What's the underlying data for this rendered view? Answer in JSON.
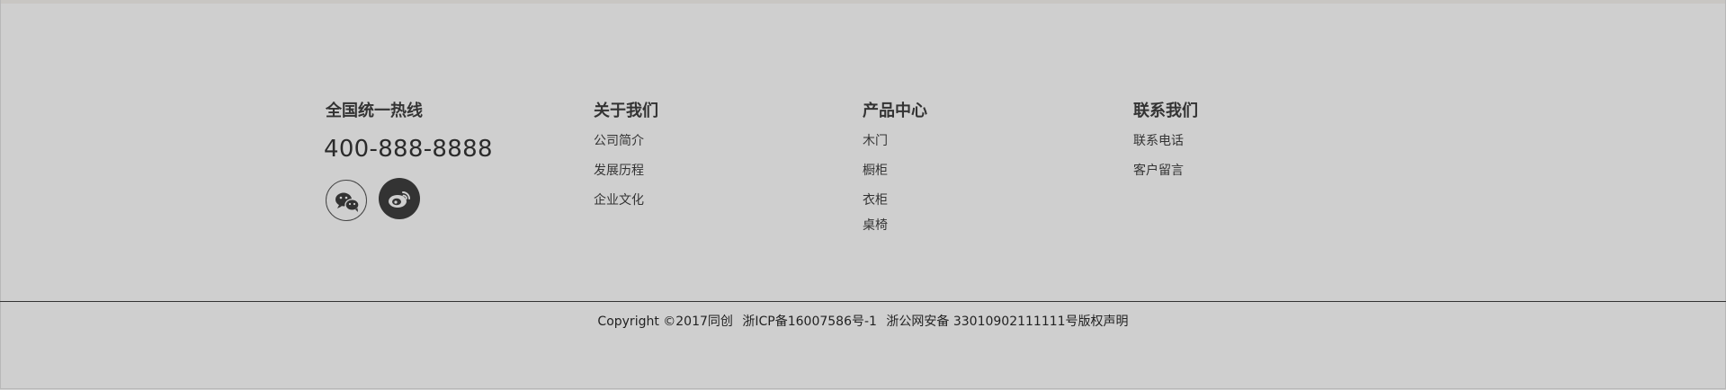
{
  "hotline": {
    "title": "全国统一热线",
    "phone": "400-888-8888",
    "icons": [
      "wechat-icon",
      "weibo-icon"
    ]
  },
  "about": {
    "title": "关于我们",
    "links": [
      "公司简介",
      "发展历程",
      "企业文化"
    ]
  },
  "products": {
    "title": "产品中心",
    "links": [
      "木门",
      "橱柜",
      "衣柜",
      "桌椅"
    ]
  },
  "contact": {
    "title": "联系我们",
    "links": [
      "联系电话",
      "客户留言"
    ]
  },
  "copyright": {
    "text": "Copyright ©2017同创",
    "icp": "浙ICP备16007586号-1",
    "police": "浙公网安备 33010902111111号版权声明"
  },
  "colors": {
    "background": "#cfcfcf",
    "text": "#333333",
    "divider": "#333333"
  }
}
